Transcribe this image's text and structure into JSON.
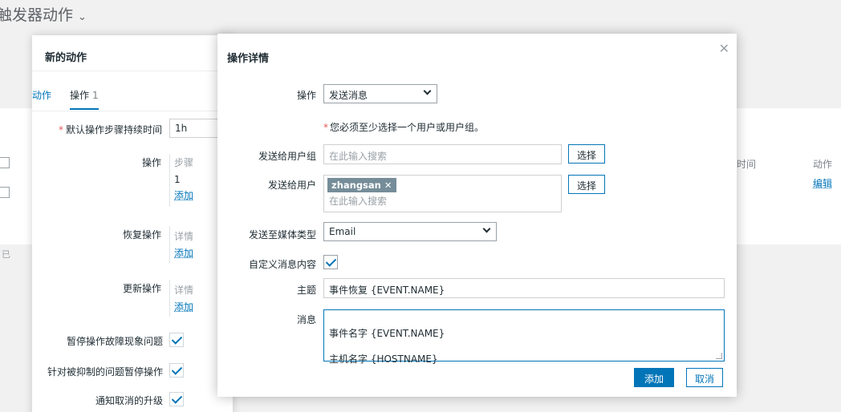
{
  "page": {
    "title": "触发器动作"
  },
  "background": {
    "col_time": "时间",
    "col_action": "动作",
    "edit_link": "编辑",
    "side_text": "已"
  },
  "action_window": {
    "title": "新的动作",
    "tabs": [
      {
        "label": "动作"
      },
      {
        "label": "操作",
        "count": "1"
      }
    ],
    "default_duration": {
      "label": "默认操作步骤持续时间",
      "value": "1h"
    },
    "operations": {
      "label": "操作",
      "col": "步骤",
      "row_value": "1",
      "add": "添加"
    },
    "recovery": {
      "label": "恢复操作",
      "col": "详情",
      "add": "添加"
    },
    "update": {
      "label": "更新操作",
      "col": "详情",
      "add": "添加"
    },
    "checks": [
      {
        "label": "暂停操作故障现象问题"
      },
      {
        "label": "针对被抑制的问题暂停操作"
      },
      {
        "label": "通知取消的升级"
      }
    ]
  },
  "dialog": {
    "title": "操作详情",
    "operation": {
      "label": "操作",
      "value": "发送消息"
    },
    "required_note": "您必须至少选择一个用户或用户组。",
    "send_to_groups": {
      "label": "发送给用户组",
      "placeholder": "在此输入搜索",
      "button": "选择"
    },
    "send_to_users": {
      "label": "发送给用户",
      "tag": "zhangsan",
      "placeholder": "在此输入搜索",
      "button": "选择"
    },
    "media_type": {
      "label": "发送至媒体类型",
      "value": "Email"
    },
    "custom_message": {
      "label": "自定义消息内容",
      "checked": true
    },
    "subject": {
      "label": "主题",
      "value": "事件恢复 {EVENT.NAME}"
    },
    "message": {
      "label": "消息",
      "line1": "事件名字 {EVENT.NAME}",
      "line2": "主机名字 {HOSTNAME}"
    },
    "add_button": "添加",
    "cancel_button": "取消"
  },
  "colors": {
    "accent": "#0275b8",
    "required": "#e45959",
    "tag_bg": "#768d99"
  }
}
